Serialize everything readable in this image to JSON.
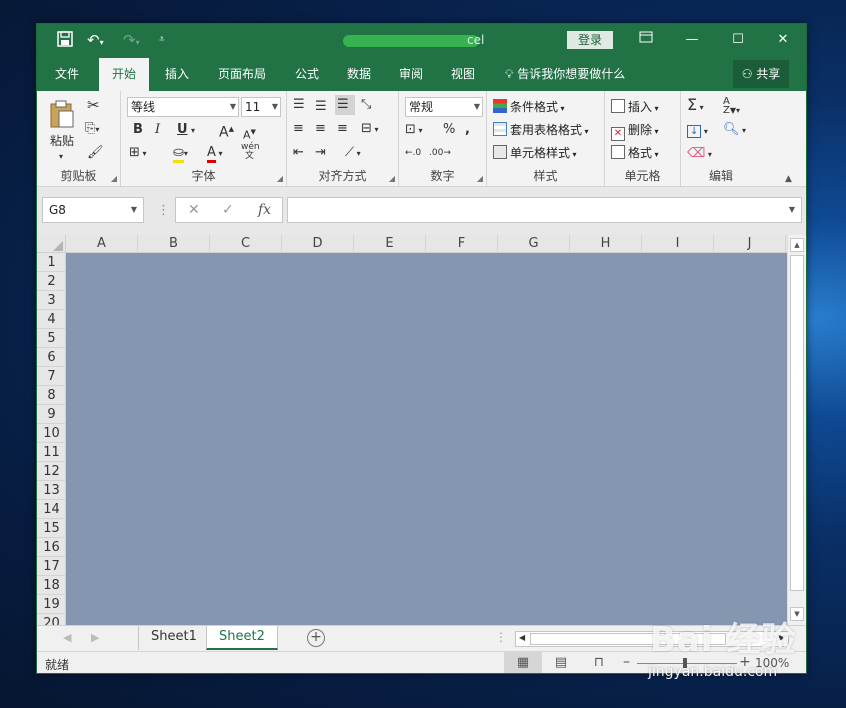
{
  "window": {
    "title_suffix": "cel"
  },
  "titlebar": {
    "login_label": "登录"
  },
  "tabs": [
    "文件",
    "开始",
    "插入",
    "页面布局",
    "公式",
    "数据",
    "审阅",
    "视图"
  ],
  "active_tab": "开始",
  "tell_me": "告诉我你想要做什么",
  "share": "共享",
  "ribbon": {
    "clipboard": {
      "label": "剪贴板",
      "paste_label": "粘贴"
    },
    "font": {
      "label": "字体",
      "font_name": "等线",
      "font_size": "11",
      "bold": "B",
      "italic": "I",
      "underline": "U",
      "phonetic": "wén",
      "phonetic_sub": "文"
    },
    "alignment": {
      "label": "对齐方式"
    },
    "number": {
      "label": "数字",
      "format": "常规"
    },
    "styles": {
      "label": "样式",
      "conditional": "条件格式",
      "table_format": "套用表格格式",
      "cell_styles": "单元格样式"
    },
    "cells": {
      "label": "单元格",
      "insert": "插入",
      "delete": "删除",
      "format": "格式"
    },
    "editing": {
      "label": "编辑"
    }
  },
  "formula_bar": {
    "name_box": "G8",
    "fx": "fx",
    "value": ""
  },
  "columns": [
    "A",
    "B",
    "C",
    "D",
    "E",
    "F",
    "G",
    "H",
    "I",
    "J"
  ],
  "rows": [
    "1",
    "2",
    "3",
    "4",
    "5",
    "6",
    "7",
    "8",
    "9",
    "10",
    "11",
    "12",
    "13",
    "14",
    "15",
    "16",
    "17",
    "18",
    "19",
    "20"
  ],
  "sheets": [
    "Sheet1",
    "Sheet2"
  ],
  "active_sheet": "Sheet2",
  "status": {
    "text": "就绪",
    "zoom": "100%"
  },
  "colors": {
    "excel_green": "#217346",
    "sheet_fill": "#8597b0"
  },
  "watermark": {
    "logo": "Bai 经验",
    "url": "jingyan.baidu.com"
  }
}
